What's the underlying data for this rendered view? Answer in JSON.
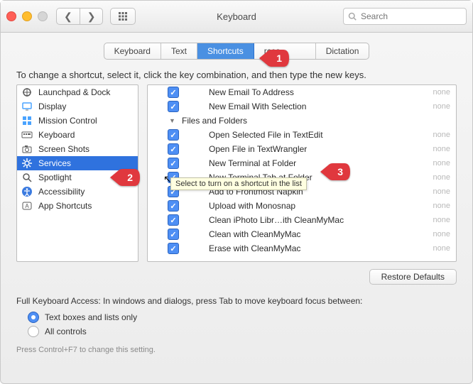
{
  "window": {
    "title": "Keyboard"
  },
  "search": {
    "placeholder": "Search"
  },
  "tabs": {
    "items": [
      {
        "label": "Keyboard"
      },
      {
        "label": "Text"
      },
      {
        "label": "Shortcuts"
      },
      {
        "label": "Input Sources"
      },
      {
        "label": "Dictation"
      }
    ],
    "active_index": 2,
    "obscured_index": 3,
    "obscured_visible_suffix": "rces"
  },
  "instruction": "To change a shortcut, select it, click the key combination, and then type the new keys.",
  "categories": [
    {
      "label": "Launchpad & Dock",
      "icon": "launchpad-icon"
    },
    {
      "label": "Display",
      "icon": "display-icon"
    },
    {
      "label": "Mission Control",
      "icon": "mission-control-icon"
    },
    {
      "label": "Keyboard",
      "icon": "keyboard-icon"
    },
    {
      "label": "Screen Shots",
      "icon": "camera-icon"
    },
    {
      "label": "Services",
      "icon": "gear-icon",
      "selected": true
    },
    {
      "label": "Spotlight",
      "icon": "spotlight-icon"
    },
    {
      "label": "Accessibility",
      "icon": "accessibility-icon"
    },
    {
      "label": "App Shortcuts",
      "icon": "app-shortcuts-icon"
    }
  ],
  "services": [
    {
      "kind": "item",
      "checked": true,
      "label": "New Email To Address",
      "shortcut": "none"
    },
    {
      "kind": "item",
      "checked": true,
      "label": "New Email With Selection",
      "shortcut": "none"
    },
    {
      "kind": "group",
      "expanded": true,
      "label": "Files and Folders"
    },
    {
      "kind": "item",
      "checked": true,
      "label": "Open Selected File in TextEdit",
      "shortcut": "none"
    },
    {
      "kind": "item",
      "checked": true,
      "label": "Open File in TextWrangler",
      "shortcut": "none"
    },
    {
      "kind": "item",
      "checked": true,
      "label": "New Terminal at Folder",
      "shortcut": "none"
    },
    {
      "kind": "item",
      "checked": true,
      "label": "New Terminal Tab at Folder",
      "shortcut": "none"
    },
    {
      "kind": "item",
      "checked": true,
      "label": "Add to Frontmost Napkin",
      "shortcut": "none"
    },
    {
      "kind": "item",
      "checked": true,
      "label": "Upload with Monosnap",
      "shortcut": "none"
    },
    {
      "kind": "item",
      "checked": true,
      "label": "Clean iPhoto Libr…ith CleanMyMac",
      "shortcut": "none"
    },
    {
      "kind": "item",
      "checked": true,
      "label": "Clean with CleanMyMac",
      "shortcut": "none"
    },
    {
      "kind": "item",
      "checked": true,
      "label": "Erase with CleanMyMac",
      "shortcut": "none"
    }
  ],
  "tooltip": "Select to turn on a shortcut in the list",
  "restore_label": "Restore Defaults",
  "full_access": {
    "text": "Full Keyboard Access: In windows and dialogs, press Tab to move keyboard focus between:",
    "options": [
      {
        "label": "Text boxes and lists only",
        "selected": true
      },
      {
        "label": "All controls",
        "selected": false
      }
    ],
    "hint": "Press Control+F7 to change this setting."
  },
  "callouts": [
    {
      "n": "1",
      "target": "tab-shortcuts"
    },
    {
      "n": "2",
      "target": "category-services"
    },
    {
      "n": "3",
      "target": "service-new-terminal-at-folder"
    }
  ]
}
